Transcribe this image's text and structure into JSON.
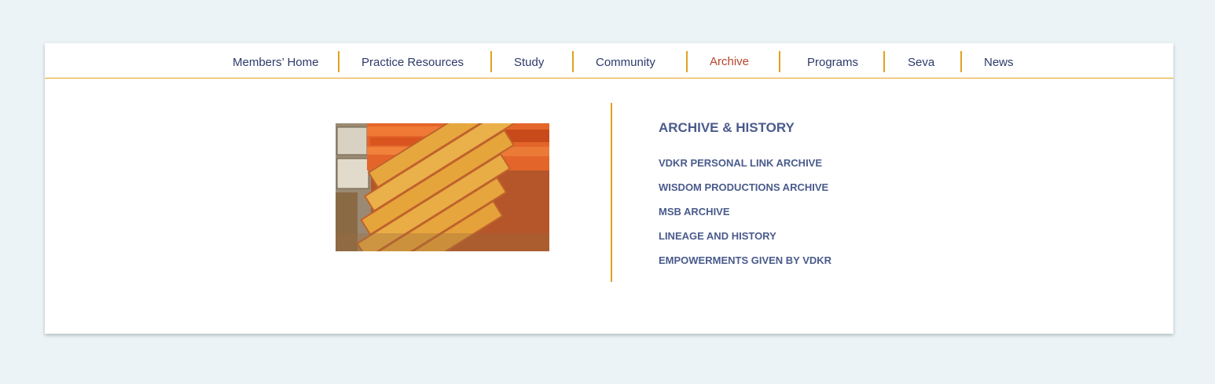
{
  "nav": {
    "items": [
      {
        "label": "Members’ Home"
      },
      {
        "label": "Practice Resources"
      },
      {
        "label": "Study"
      },
      {
        "label": "Community"
      },
      {
        "label": "Archive"
      },
      {
        "label": "Programs"
      },
      {
        "label": "Seva"
      },
      {
        "label": "News"
      }
    ],
    "active": "Archive"
  },
  "menu": {
    "heading": "ARCHIVE & HISTORY",
    "links": [
      {
        "label": "VDKR PERSONAL LINK ARCHIVE"
      },
      {
        "label": "WISDOM PRODUCTIONS ARCHIVE"
      },
      {
        "label": "MSB ARCHIVE"
      },
      {
        "label": "LINEAGE AND HISTORY"
      },
      {
        "label": "EMPOWERMENTS GIVEN BY VDKR"
      }
    ]
  },
  "colors": {
    "background": "#ebf3f6",
    "nav_text": "#2d3a6b",
    "active_text": "#b8452e",
    "accent": "#e3a11f",
    "menu_text": "#4a5b8c"
  }
}
